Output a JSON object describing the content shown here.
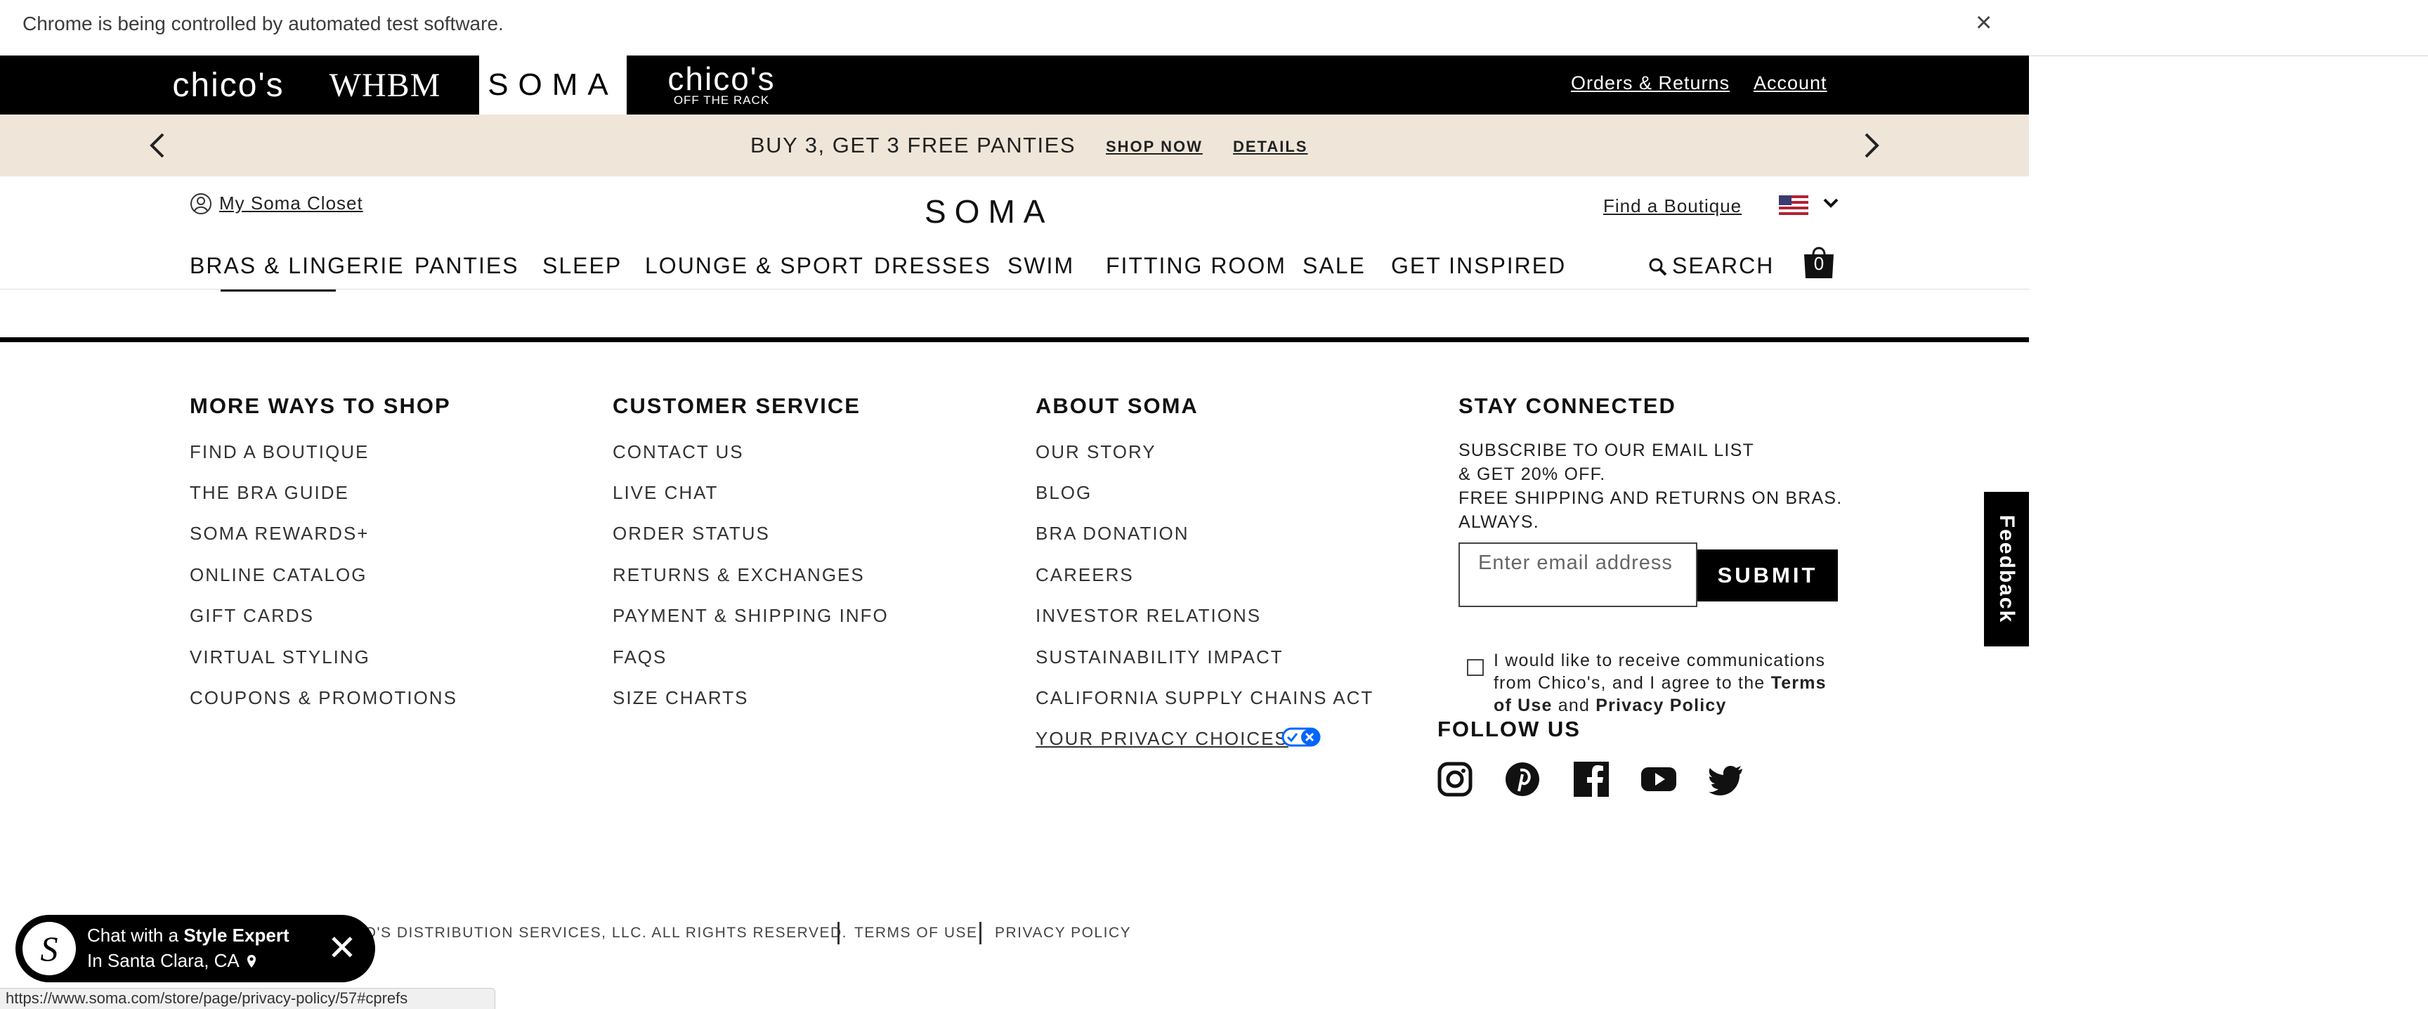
{
  "browser": {
    "infobar_text": "Chrome is being controlled by automated test software.",
    "close_glyph": "×",
    "status_url": "https://www.soma.com/store/page/privacy-policy/57#cprefs"
  },
  "brand_bar": {
    "brands": [
      "chico's",
      "WHBM",
      "SOMA",
      "chico's",
      "OFF THE RACK"
    ],
    "orders_returns": "Orders & Returns",
    "account": "Account"
  },
  "promo": {
    "text": "BUY 3, GET 3 FREE PANTIES",
    "shop_now": "SHOP NOW",
    "details": "DETAILS",
    "prev": "‹",
    "next": "›"
  },
  "header": {
    "my_closet": "My Soma Closet",
    "logo": "SOMA",
    "find_boutique": "Find a Boutique",
    "country_flag": "us-flag-icon",
    "search": "SEARCH",
    "cart_count": "0"
  },
  "nav": {
    "items": [
      "BRAS & LINGERIE",
      "PANTIES",
      "SLEEP",
      "LOUNGE & SPORT",
      "DRESSES",
      "SWIM",
      "FITTING ROOM",
      "SALE",
      "GET INSPIRED"
    ]
  },
  "footer": {
    "more_ways": {
      "heading": "MORE WAYS TO SHOP",
      "links": [
        "FIND A BOUTIQUE",
        "THE BRA GUIDE",
        "SOMA REWARDS+",
        "ONLINE CATALOG",
        "GIFT CARDS",
        "VIRTUAL STYLING",
        "COUPONS & PROMOTIONS"
      ]
    },
    "customer_service": {
      "heading": "CUSTOMER SERVICE",
      "links": [
        "CONTACT US",
        "LIVE CHAT",
        "ORDER STATUS",
        "RETURNS & EXCHANGES",
        "PAYMENT & SHIPPING INFO",
        "FAQS",
        "SIZE CHARTS"
      ]
    },
    "about": {
      "heading": "ABOUT SOMA",
      "links": [
        "OUR STORY",
        "BLOG",
        "BRA DONATION",
        "CAREERS",
        "INVESTOR RELATIONS",
        "SUSTAINABILITY IMPACT",
        "CALIFORNIA SUPPLY CHAINS ACT",
        "YOUR PRIVACY CHOICES"
      ]
    },
    "stay_connected": {
      "heading": "STAY CONNECTED",
      "lines": [
        "SUBSCRIBE TO OUR EMAIL LIST",
        "& GET 20% OFF.",
        "FREE SHIPPING AND RETURNS ON BRAS.",
        "ALWAYS."
      ],
      "email_placeholder": "Enter email address",
      "submit": "SUBMIT",
      "consent": {
        "line1": "I would like to receive communications",
        "line2": "from Chico's, and I agree to the",
        "terms": "Terms",
        "of_use": "of Use",
        "and": "and",
        "privacy": "Privacy Policy"
      }
    },
    "follow_us": {
      "heading": "FOLLOW US",
      "icons": [
        "instagram-icon",
        "pinterest-icon",
        "facebook-icon",
        "youtube-icon",
        "twitter-icon"
      ]
    },
    "legal": {
      "copyright": "CO'S DISTRIBUTION SERVICES, LLC. ALL RIGHTS RESERVED.",
      "terms": "TERMS OF USE",
      "privacy": "PRIVACY POLICY"
    }
  },
  "feedback": "Feedback",
  "chat": {
    "avatar_letter": "S",
    "prefix": "Chat with a",
    "bold": "Style Expert",
    "location": "In Santa Clara, CA",
    "close": "✕"
  }
}
